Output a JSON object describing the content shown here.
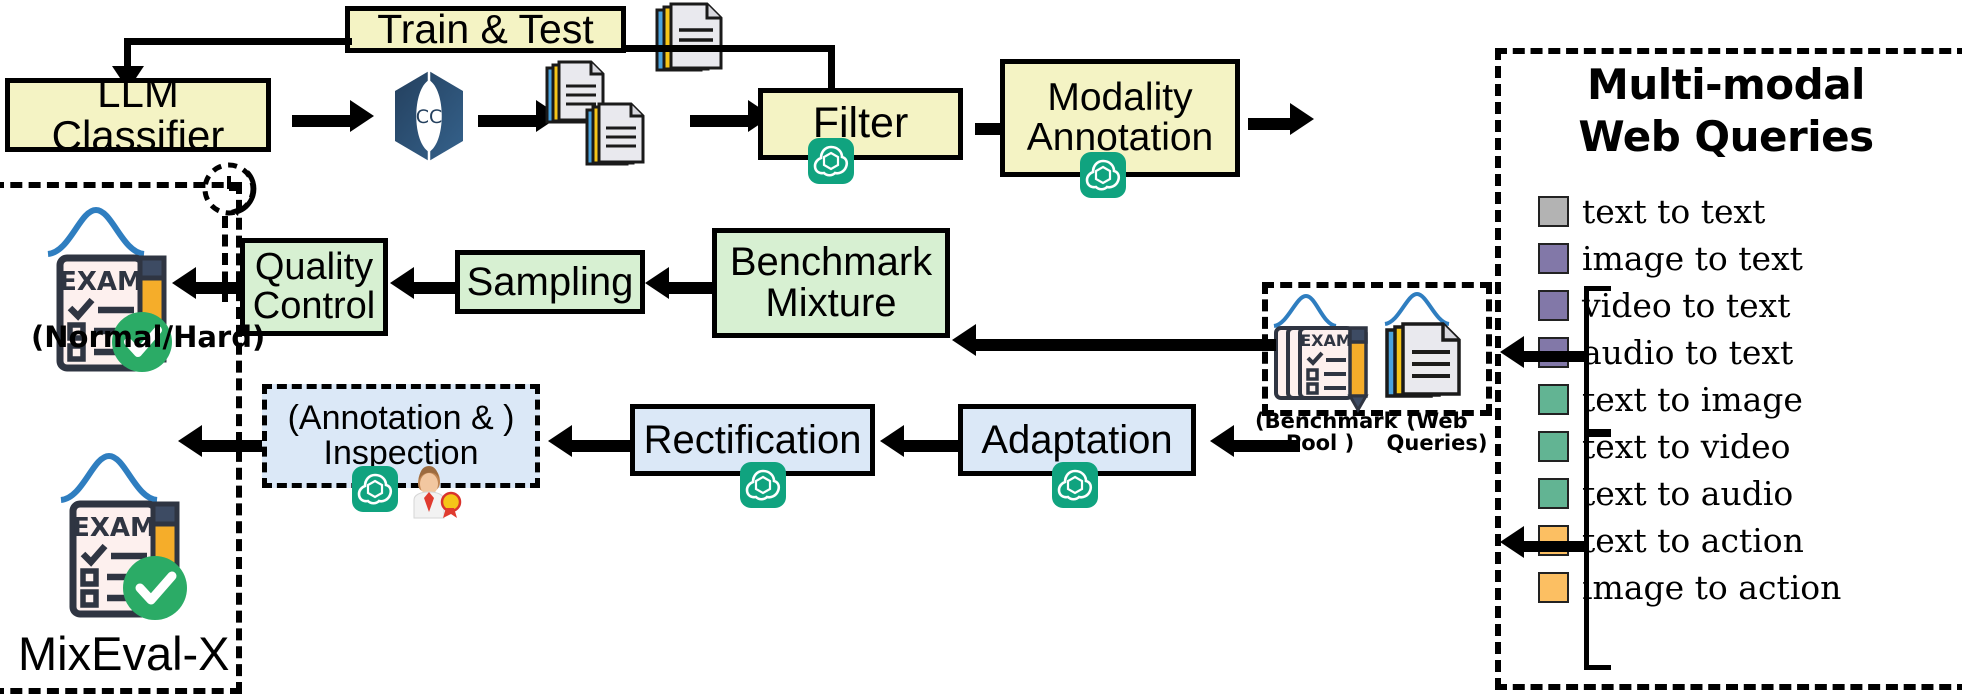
{
  "pipeline": {
    "top_row": {
      "train_test": "Train & Test",
      "llm_classifier": "LLM Classifier",
      "common_crawl_icon": "CC",
      "filter": "Filter",
      "modality_annotation_line1": "Modality",
      "modality_annotation_line2": "Annotation"
    },
    "middle_row": {
      "quality_control_line1": "Quality",
      "quality_control_line2": "Control",
      "sampling": "Sampling",
      "benchmark_mixture_line1": "Benchmark",
      "benchmark_mixture_line2": "Mixture",
      "normal_hard": "(Normal/Hard)"
    },
    "bottom_row": {
      "annotation_inspection_line1": "(Annotation & )",
      "annotation_inspection_line2": "Inspection",
      "rectification": "Rectification",
      "adaptation": "Adaptation",
      "mixeval_x": "MixEval-X"
    },
    "sources": {
      "benchmark_pool_line1": "(Benchmark",
      "benchmark_pool_line2": "Pool )",
      "web_queries_line1": "(Web",
      "web_queries_line2": "Queries)"
    }
  },
  "legend_panel": {
    "title_line1": "Multi-modal",
    "title_line2": "Web Queries",
    "items": [
      {
        "label": "text to text",
        "color": "#b3b3b3"
      },
      {
        "label": "image to text",
        "color": "#8278a8"
      },
      {
        "label": "video to text",
        "color": "#8278a8"
      },
      {
        "label": "audio to text",
        "color": "#8278a8"
      },
      {
        "label": "text to image",
        "color": "#62b493"
      },
      {
        "label": "text to video",
        "color": "#62b493"
      },
      {
        "label": "text to audio",
        "color": "#62b493"
      },
      {
        "label": "text to action",
        "color": "#fcbf62"
      },
      {
        "label": "image to action",
        "color": "#fcbf62"
      }
    ]
  },
  "colors": {
    "yellow_box": "#f4f3c4",
    "green_box": "#d7f0d2",
    "blue_box": "#dbe8f7",
    "stroke": "#000000",
    "gpt_green": "#10a37f",
    "check_green": "#2bab66",
    "curve_blue": "#2f7ec0",
    "cc_navy": "#1f3b59"
  },
  "icons": {
    "gpt": "openai-gpt-icon",
    "clock": "clock-icon",
    "exam": "exam-clipboard-icon",
    "doc": "document-icon",
    "check": "green-check-icon",
    "human": "human-expert-icon",
    "cc": "common-crawl-icon"
  }
}
